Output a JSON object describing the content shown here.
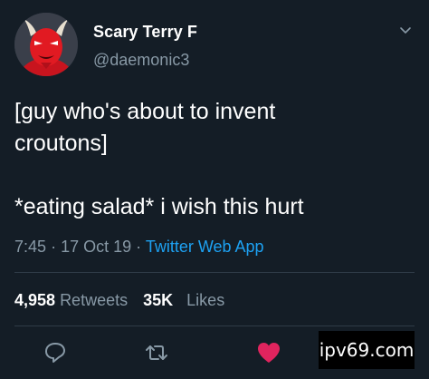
{
  "user": {
    "display_name": "Scary Terry F",
    "handle": "@daemonic3"
  },
  "tweet": {
    "text": "[guy who's about to invent\ncroutons]\n\n*eating salad* i wish this hurt",
    "time": "7:45",
    "date": "17 Oct 19",
    "source": "Twitter Web App",
    "separator": "·"
  },
  "stats": {
    "retweets_count": "4,958",
    "retweets_label": "Retweets",
    "likes_count": "35K",
    "likes_label": "Likes"
  },
  "actions": {
    "liked": true,
    "like_color": "#e0245e",
    "icon_color": "#8899a6"
  },
  "watermark": {
    "text": "ipv69.com"
  },
  "colors": {
    "background": "#141d26",
    "link": "#1da1f2",
    "secondary_text": "#8899a6"
  }
}
